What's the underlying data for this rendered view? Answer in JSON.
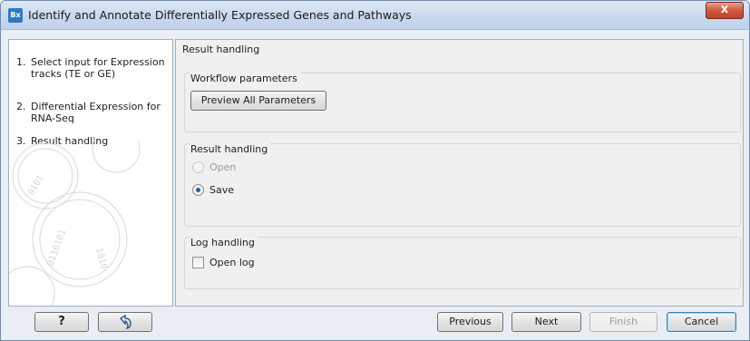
{
  "window": {
    "app_icon_text": "Bx",
    "title": "Identify and Annotate Differentially Expressed Genes and Pathways",
    "close_glyph": "x"
  },
  "steps": [
    {
      "num": "1.",
      "label": "Select input for Expression tracks (TE or GE)"
    },
    {
      "num": "2.",
      "label": "Differential Expression for RNA-Seq"
    },
    {
      "num": "3.",
      "label": "Result handling"
    }
  ],
  "main": {
    "title": "Result handling",
    "workflow_group": {
      "title": "Workflow parameters",
      "preview_button": "Preview All Parameters"
    },
    "result_group": {
      "title": "Result handling",
      "options": [
        {
          "label": "Open",
          "selected": false,
          "enabled": false
        },
        {
          "label": "Save",
          "selected": true,
          "enabled": true
        }
      ]
    },
    "log_group": {
      "title": "Log handling",
      "checkbox_label": "Open log",
      "checked": false
    }
  },
  "footer": {
    "help_label": "?",
    "reset_icon": "undo-arrow-icon",
    "previous_label": "Previous",
    "next_label": "Next",
    "finish_label": "Finish",
    "cancel_label": "Cancel"
  },
  "colors": {
    "selection_blue": "#1d5fa8",
    "close_red": "#c2412a",
    "panel_border": "#9fb0c5"
  }
}
